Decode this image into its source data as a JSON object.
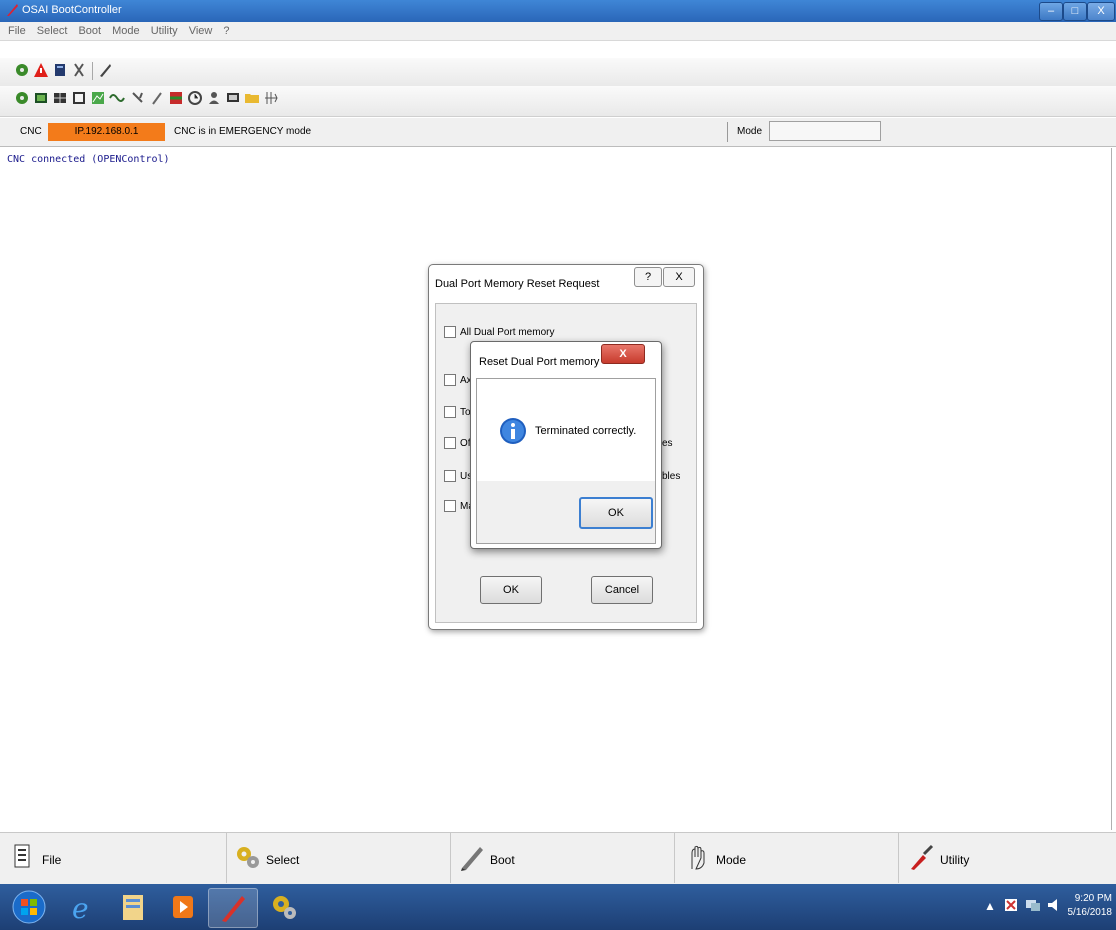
{
  "window": {
    "title": "OSAI BootController",
    "min": "–",
    "max": "□",
    "close": "X"
  },
  "menu": [
    "File",
    "Select",
    "Boot",
    "Mode",
    "Utility",
    "View",
    "?"
  ],
  "status": {
    "cnc_label": "CNC",
    "ip": "IP.192.168.0.1",
    "message": "CNC is in EMERGENCY mode",
    "mode_label": "Mode",
    "ip_color": "#f37b1a"
  },
  "console": {
    "line1": "CNC connected (OPENControl)"
  },
  "dialog_reset_request": {
    "title": "Dual Port Memory Reset Request",
    "help": "?",
    "close": "X",
    "options": [
      "All Dual Port memory",
      "Axe",
      "To",
      "Off",
      "Use",
      "Ma"
    ],
    "option_suffix_3": "es",
    "option_suffix_4": "bles",
    "ok": "OK",
    "cancel": "Cancel"
  },
  "dialog_message": {
    "title": "Reset Dual Port memory",
    "close": "X",
    "message": "Terminated correctly.",
    "ok": "OK",
    "icon": "info-icon"
  },
  "function_bar": {
    "file": "File",
    "select": "Select",
    "boot": "Boot",
    "mode": "Mode",
    "utility": "Utility"
  },
  "tray": {
    "time": "9:20 PM",
    "date": "5/16/2018"
  }
}
